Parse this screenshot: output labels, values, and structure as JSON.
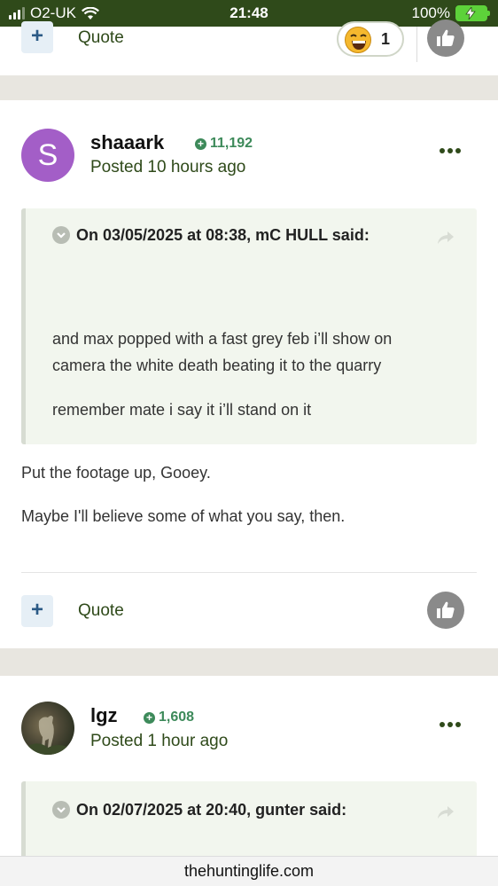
{
  "status_bar": {
    "carrier": "O2-UK",
    "time": "21:48",
    "battery": "100%"
  },
  "top_card": {
    "quote_label": "Quote",
    "reaction_count": "1"
  },
  "posts": [
    {
      "avatar_letter": "S",
      "username": "shaaark",
      "reputation": "11,192",
      "posted": "Posted 10 hours ago",
      "quote": {
        "header": "On 03/05/2025 at 08:38, mC HULL said:",
        "line1": "and max popped with a fast grey feb i’ll show on",
        "line2": "camera the white death beating it to the quarry",
        "line3": "remember mate i say it i’ll stand on it"
      },
      "body_line1": "Put the footage up, Gooey.",
      "body_line2": "Maybe I'll believe some of what you say, then.",
      "quote_label": "Quote"
    },
    {
      "username": "lgz",
      "reputation": "1,608",
      "posted": "Posted 1 hour ago",
      "quote": {
        "header": "On 02/07/2025 at 20:40, gunter said:"
      }
    }
  ],
  "url_bar": {
    "domain": "thehuntinglife.com"
  },
  "colors": {
    "status_bar_bg": "#2f4a1a",
    "accent_green": "#2f4a1a",
    "reputation_green": "#3d8a5a",
    "avatar_purple": "#a35ec7",
    "quote_bg": "#f2f6ee"
  }
}
